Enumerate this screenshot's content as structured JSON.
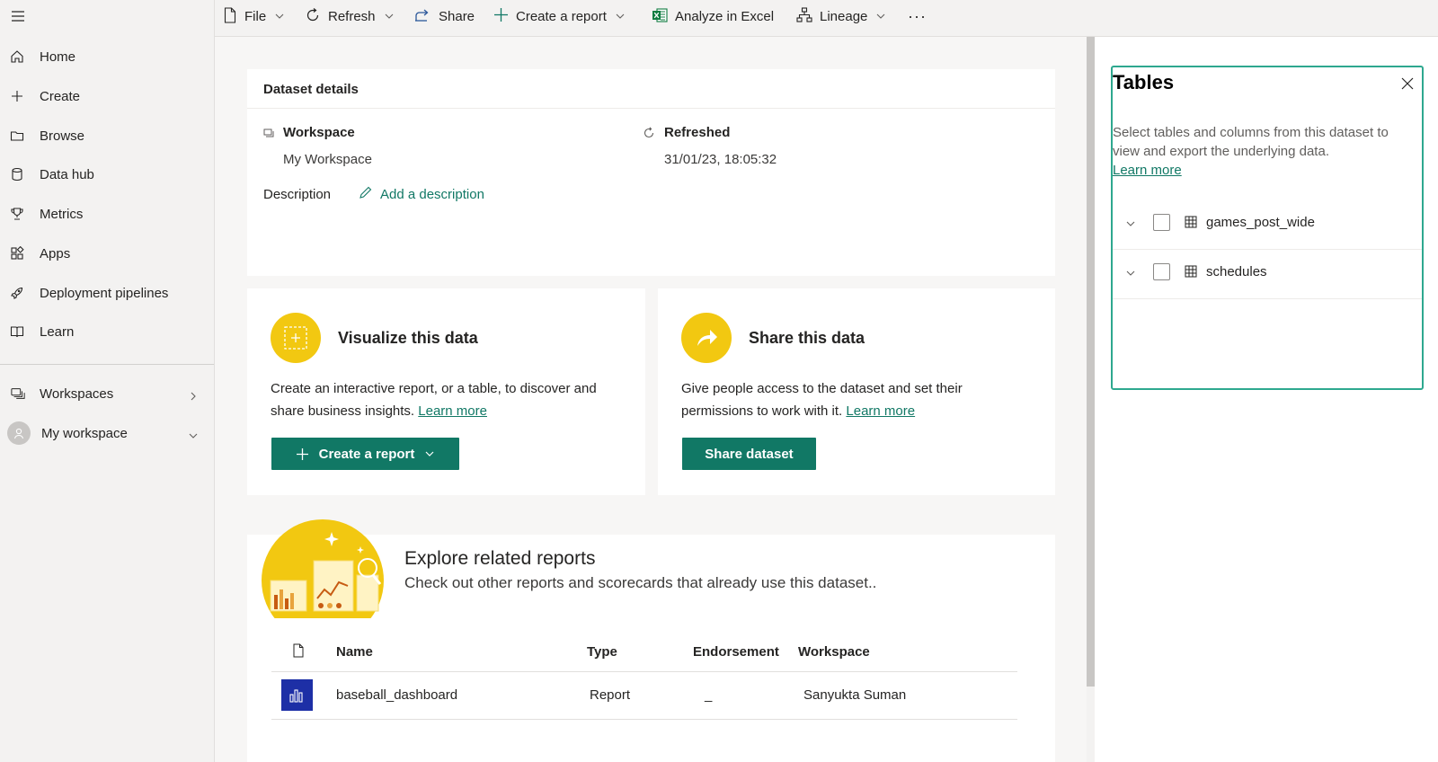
{
  "sidebar": {
    "menu_icon": "hamburger-icon",
    "items": [
      {
        "label": "Home",
        "icon": "home-icon"
      },
      {
        "label": "Create",
        "icon": "plus-icon"
      },
      {
        "label": "Browse",
        "icon": "folder-icon"
      },
      {
        "label": "Data hub",
        "icon": "database-icon"
      },
      {
        "label": "Metrics",
        "icon": "trophy-icon"
      },
      {
        "label": "Apps",
        "icon": "apps-icon"
      },
      {
        "label": "Deployment pipelines",
        "icon": "rocket-icon"
      },
      {
        "label": "Learn",
        "icon": "book-icon"
      }
    ],
    "workspaces_label": "Workspaces",
    "my_workspace_label": "My workspace"
  },
  "toolbar": {
    "file": "File",
    "refresh": "Refresh",
    "share": "Share",
    "create_report": "Create a report",
    "analyze_excel": "Analyze in Excel",
    "lineage": "Lineage",
    "more": "···"
  },
  "details": {
    "header": "Dataset details",
    "workspace_label": "Workspace",
    "workspace_value": "My Workspace",
    "refreshed_label": "Refreshed",
    "refreshed_value": "31/01/23, 18:05:32",
    "description_label": "Description",
    "add_description": "Add a description"
  },
  "visualize": {
    "title": "Visualize this data",
    "text": "Create an interactive report, or a table, to discover and share business insights.",
    "learn_more": "Learn more",
    "button": "Create a report"
  },
  "share": {
    "title": "Share this data",
    "text": "Give people access to the dataset and set their permissions to work with it.",
    "learn_more": "Learn more",
    "button": "Share dataset"
  },
  "explore": {
    "title": "Explore related reports",
    "subtitle": "Check out other reports and scorecards that already use this dataset..",
    "columns": [
      "Name",
      "Type",
      "Endorsement",
      "Workspace"
    ],
    "rows": [
      {
        "name": "baseball_dashboard",
        "type": "Report",
        "endorsement": "_",
        "workspace": "Sanyukta Suman"
      }
    ]
  },
  "tables_panel": {
    "title": "Tables",
    "description": "Select tables and columns from this dataset to view and export the underlying data.",
    "learn_more": "Learn more",
    "tables": [
      {
        "name": "games_post_wide"
      },
      {
        "name": "schedules"
      }
    ]
  },
  "colors": {
    "accent": "#117865",
    "yellow": "#f2c811",
    "report_tile": "#1d2fa6",
    "panel_border": "#2ea88f"
  }
}
